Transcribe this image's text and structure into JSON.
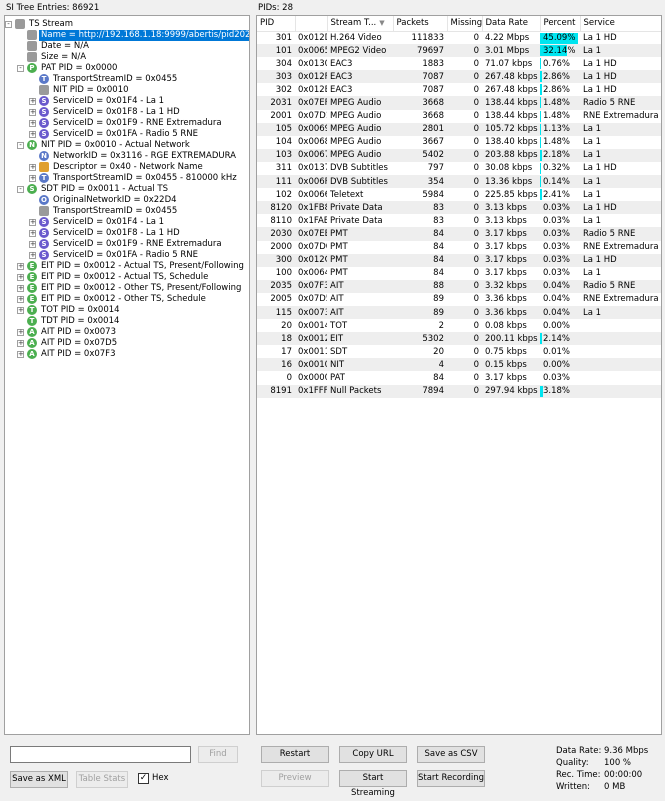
{
  "left_header": "SI Tree Entries: 86921",
  "right_header": "PIDs: 28",
  "tree": [
    {
      "label": "TS Stream",
      "icon": "",
      "color": "#9a9a9a",
      "level": 0,
      "expander": "-"
    },
    {
      "label": "Name = http://192.168.1.18:9999/abertis/pid2025",
      "icon": "",
      "color": "#9a9a9a",
      "level": 1,
      "selected": true
    },
    {
      "label": "Date = N/A",
      "icon": "",
      "color": "#9a9a9a",
      "level": 1
    },
    {
      "label": "Size = N/A",
      "icon": "",
      "color": "#9a9a9a",
      "level": 1
    },
    {
      "label": "PAT PID = 0x0000",
      "icon": "P",
      "color": "#4caf50",
      "level": 1,
      "expander": "-"
    },
    {
      "label": "TransportStreamID = 0x0455",
      "icon": "T",
      "color": "#5a78c8",
      "level": 2
    },
    {
      "label": "NIT PID = 0x0010",
      "icon": "",
      "color": "#9a9a9a",
      "level": 2
    },
    {
      "label": "ServiceID = 0x01F4 - La 1",
      "icon": "S",
      "color": "#6a5acd",
      "level": 2,
      "expander": "+"
    },
    {
      "label": "ServiceID = 0x01F8 - La 1 HD",
      "icon": "S",
      "color": "#6a5acd",
      "level": 2,
      "expander": "+"
    },
    {
      "label": "ServiceID = 0x01F9 - RNE Extremadura",
      "icon": "S",
      "color": "#6a5acd",
      "level": 2,
      "expander": "+"
    },
    {
      "label": "ServiceID = 0x01FA - Radio 5 RNE",
      "icon": "S",
      "color": "#6a5acd",
      "level": 2,
      "expander": "+"
    },
    {
      "label": "NIT PID = 0x0010 - Actual Network",
      "icon": "N",
      "color": "#4caf50",
      "level": 1,
      "expander": "-"
    },
    {
      "label": "NetworkID = 0x3116 - RGE EXTREMADURA",
      "icon": "N",
      "color": "#5a78c8",
      "level": 2
    },
    {
      "label": "Descriptor = 0x40 - Network Name",
      "icon": "",
      "color": "#e0a030",
      "level": 2,
      "expander": "+"
    },
    {
      "label": "TransportStreamID = 0x0455 - 810000 kHz",
      "icon": "T",
      "color": "#5a78c8",
      "level": 2,
      "expander": "+"
    },
    {
      "label": "SDT PID = 0x0011 - Actual TS",
      "icon": "S",
      "color": "#4caf50",
      "level": 1,
      "expander": "-"
    },
    {
      "label": "OriginalNetworkID = 0x22D4",
      "icon": "O",
      "color": "#5a78c8",
      "level": 2
    },
    {
      "label": "TransportStreamID = 0x0455",
      "icon": "",
      "color": "#9a9a9a",
      "level": 2
    },
    {
      "label": "ServiceID = 0x01F4 - La 1",
      "icon": "S",
      "color": "#6a5acd",
      "level": 2,
      "expander": "+"
    },
    {
      "label": "ServiceID = 0x01F8 - La 1 HD",
      "icon": "S",
      "color": "#6a5acd",
      "level": 2,
      "expander": "+"
    },
    {
      "label": "ServiceID = 0x01F9 - RNE Extremadura",
      "icon": "S",
      "color": "#6a5acd",
      "level": 2,
      "expander": "+"
    },
    {
      "label": "ServiceID = 0x01FA - Radio 5 RNE",
      "icon": "S",
      "color": "#6a5acd",
      "level": 2,
      "expander": "+"
    },
    {
      "label": "EIT PID = 0x0012 - Actual TS, Present/Following",
      "icon": "E",
      "color": "#4caf50",
      "level": 1,
      "expander": "+"
    },
    {
      "label": "EIT PID = 0x0012 - Actual TS, Schedule",
      "icon": "E",
      "color": "#4caf50",
      "level": 1,
      "expander": "+"
    },
    {
      "label": "EIT PID = 0x0012 - Other TS, Present/Following",
      "icon": "E",
      "color": "#4caf50",
      "level": 1,
      "expander": "+"
    },
    {
      "label": "EIT PID = 0x0012 - Other TS, Schedule",
      "icon": "E",
      "color": "#4caf50",
      "level": 1,
      "expander": "+"
    },
    {
      "label": "TOT PID = 0x0014",
      "icon": "T",
      "color": "#4caf50",
      "level": 1,
      "expander": "+"
    },
    {
      "label": "TDT PID = 0x0014",
      "icon": "T",
      "color": "#4caf50",
      "level": 1
    },
    {
      "label": "AIT PID = 0x0073",
      "icon": "A",
      "color": "#4caf50",
      "level": 1,
      "expander": "+"
    },
    {
      "label": "AIT PID = 0x07D5",
      "icon": "A",
      "color": "#4caf50",
      "level": 1,
      "expander": "+"
    },
    {
      "label": "AIT PID = 0x07F3",
      "icon": "A",
      "color": "#4caf50",
      "level": 1,
      "expander": "+"
    }
  ],
  "table": {
    "columns": [
      "PID",
      "",
      "Stream T...",
      "Packets",
      "Missing",
      "Data Rate",
      "Percent",
      "Service"
    ],
    "rows": [
      {
        "pid": "301",
        "hex": "0x012D",
        "type": "H.264 Video",
        "packets": "111833",
        "missing": "0",
        "rate": "4.22 Mbps",
        "percent": "45.09%",
        "pct": 45.09,
        "service": "La 1 HD"
      },
      {
        "pid": "101",
        "hex": "0x0065",
        "type": "MPEG2 Video",
        "packets": "79697",
        "missing": "0",
        "rate": "3.01 Mbps",
        "percent": "32.14%",
        "pct": 32.14,
        "service": "La 1"
      },
      {
        "pid": "304",
        "hex": "0x0130",
        "type": "EAC3",
        "packets": "1883",
        "missing": "0",
        "rate": "71.07 kbps",
        "percent": "0.76%",
        "pct": 0.76,
        "service": "La 1 HD"
      },
      {
        "pid": "303",
        "hex": "0x012F",
        "type": "EAC3",
        "packets": "7087",
        "missing": "0",
        "rate": "267.48 kbps",
        "percent": "2.86%",
        "pct": 2.86,
        "service": "La 1 HD"
      },
      {
        "pid": "302",
        "hex": "0x012E",
        "type": "EAC3",
        "packets": "7087",
        "missing": "0",
        "rate": "267.48 kbps",
        "percent": "2.86%",
        "pct": 2.86,
        "service": "La 1 HD"
      },
      {
        "pid": "2031",
        "hex": "0x07EF",
        "type": "MPEG Audio",
        "packets": "3668",
        "missing": "0",
        "rate": "138.44 kbps",
        "percent": "1.48%",
        "pct": 1.48,
        "service": "Radio 5 RNE"
      },
      {
        "pid": "2001",
        "hex": "0x07D1",
        "type": "MPEG Audio",
        "packets": "3668",
        "missing": "0",
        "rate": "138.44 kbps",
        "percent": "1.48%",
        "pct": 1.48,
        "service": "RNE Extremadura"
      },
      {
        "pid": "105",
        "hex": "0x0069",
        "type": "MPEG Audio",
        "packets": "2801",
        "missing": "0",
        "rate": "105.72 kbps",
        "percent": "1.13%",
        "pct": 1.13,
        "service": "La 1"
      },
      {
        "pid": "104",
        "hex": "0x0068",
        "type": "MPEG Audio",
        "packets": "3667",
        "missing": "0",
        "rate": "138.40 kbps",
        "percent": "1.48%",
        "pct": 1.48,
        "service": "La 1"
      },
      {
        "pid": "103",
        "hex": "0x0067",
        "type": "MPEG Audio",
        "packets": "5402",
        "missing": "0",
        "rate": "203.88 kbps",
        "percent": "2.18%",
        "pct": 2.18,
        "service": "La 1"
      },
      {
        "pid": "311",
        "hex": "0x0137",
        "type": "DVB Subtitles",
        "packets": "797",
        "missing": "0",
        "rate": "30.08 kbps",
        "percent": "0.32%",
        "pct": 0.32,
        "service": "La 1 HD"
      },
      {
        "pid": "111",
        "hex": "0x006F",
        "type": "DVB Subtitles",
        "packets": "354",
        "missing": "0",
        "rate": "13.36 kbps",
        "percent": "0.14%",
        "pct": 0.14,
        "service": "La 1"
      },
      {
        "pid": "102",
        "hex": "0x0066",
        "type": "Teletext",
        "packets": "5984",
        "missing": "0",
        "rate": "225.85 kbps",
        "percent": "2.41%",
        "pct": 2.41,
        "service": "La 1"
      },
      {
        "pid": "8120",
        "hex": "0x1FB8",
        "type": "Private Data",
        "packets": "83",
        "missing": "0",
        "rate": "3.13 kbps",
        "percent": "0.03%",
        "pct": 0.03,
        "service": "La 1 HD"
      },
      {
        "pid": "8110",
        "hex": "0x1FAE",
        "type": "Private Data",
        "packets": "83",
        "missing": "0",
        "rate": "3.13 kbps",
        "percent": "0.03%",
        "pct": 0.03,
        "service": "La 1"
      },
      {
        "pid": "2030",
        "hex": "0x07EE",
        "type": "PMT",
        "packets": "84",
        "missing": "0",
        "rate": "3.17 kbps",
        "percent": "0.03%",
        "pct": 0.03,
        "service": "Radio 5 RNE"
      },
      {
        "pid": "2000",
        "hex": "0x07D0",
        "type": "PMT",
        "packets": "84",
        "missing": "0",
        "rate": "3.17 kbps",
        "percent": "0.03%",
        "pct": 0.03,
        "service": "RNE Extremadura"
      },
      {
        "pid": "300",
        "hex": "0x012C",
        "type": "PMT",
        "packets": "84",
        "missing": "0",
        "rate": "3.17 kbps",
        "percent": "0.03%",
        "pct": 0.03,
        "service": "La 1 HD"
      },
      {
        "pid": "100",
        "hex": "0x0064",
        "type": "PMT",
        "packets": "84",
        "missing": "0",
        "rate": "3.17 kbps",
        "percent": "0.03%",
        "pct": 0.03,
        "service": "La 1"
      },
      {
        "pid": "2035",
        "hex": "0x07F3",
        "type": "AIT",
        "packets": "88",
        "missing": "0",
        "rate": "3.32 kbps",
        "percent": "0.04%",
        "pct": 0.04,
        "service": "Radio 5 RNE"
      },
      {
        "pid": "2005",
        "hex": "0x07D5",
        "type": "AIT",
        "packets": "89",
        "missing": "0",
        "rate": "3.36 kbps",
        "percent": "0.04%",
        "pct": 0.04,
        "service": "RNE Extremadura"
      },
      {
        "pid": "115",
        "hex": "0x0073",
        "type": "AIT",
        "packets": "89",
        "missing": "0",
        "rate": "3.36 kbps",
        "percent": "0.04%",
        "pct": 0.04,
        "service": "La 1"
      },
      {
        "pid": "20",
        "hex": "0x0014",
        "type": "TOT",
        "packets": "2",
        "missing": "0",
        "rate": "0.08 kbps",
        "percent": "0.00%",
        "pct": 0.0,
        "service": ""
      },
      {
        "pid": "18",
        "hex": "0x0012",
        "type": "EIT",
        "packets": "5302",
        "missing": "0",
        "rate": "200.11 kbps",
        "percent": "2.14%",
        "pct": 2.14,
        "service": ""
      },
      {
        "pid": "17",
        "hex": "0x0011",
        "type": "SDT",
        "packets": "20",
        "missing": "0",
        "rate": "0.75 kbps",
        "percent": "0.01%",
        "pct": 0.01,
        "service": ""
      },
      {
        "pid": "16",
        "hex": "0x0010",
        "type": "NIT",
        "packets": "4",
        "missing": "0",
        "rate": "0.15 kbps",
        "percent": "0.00%",
        "pct": 0.0,
        "service": ""
      },
      {
        "pid": "0",
        "hex": "0x0000",
        "type": "PAT",
        "packets": "84",
        "missing": "0",
        "rate": "3.17 kbps",
        "percent": "0.03%",
        "pct": 0.03,
        "service": ""
      },
      {
        "pid": "8191",
        "hex": "0x1FFF",
        "type": "Null Packets",
        "packets": "7894",
        "missing": "0",
        "rate": "297.94 kbps",
        "percent": "3.18%",
        "pct": 3.18,
        "service": ""
      }
    ]
  },
  "controls": {
    "search_value": "",
    "find_label": "Find",
    "save_xml_label": "Save as XML",
    "table_stats_label": "Table Stats",
    "hex_label": "Hex",
    "hex_checked": true,
    "restart_label": "Restart",
    "copy_url_label": "Copy URL",
    "save_csv_label": "Save as CSV",
    "preview_label": "Preview",
    "start_streaming_label": "Start Streaming",
    "start_recording_label": "Start Recording"
  },
  "stats": {
    "data_rate_label": "Data Rate:",
    "data_rate_value": "9.36 Mbps",
    "quality_label": "Quality:",
    "quality_value": "100 %",
    "rec_time_label": "Rec. Time:",
    "rec_time_value": "00:00:00",
    "written_label": "Written:",
    "written_value": "0 MB"
  },
  "colors": {
    "selection": "#0078d7",
    "percent_bar": "#00e5f0",
    "alt_row": "#eeeeee"
  }
}
